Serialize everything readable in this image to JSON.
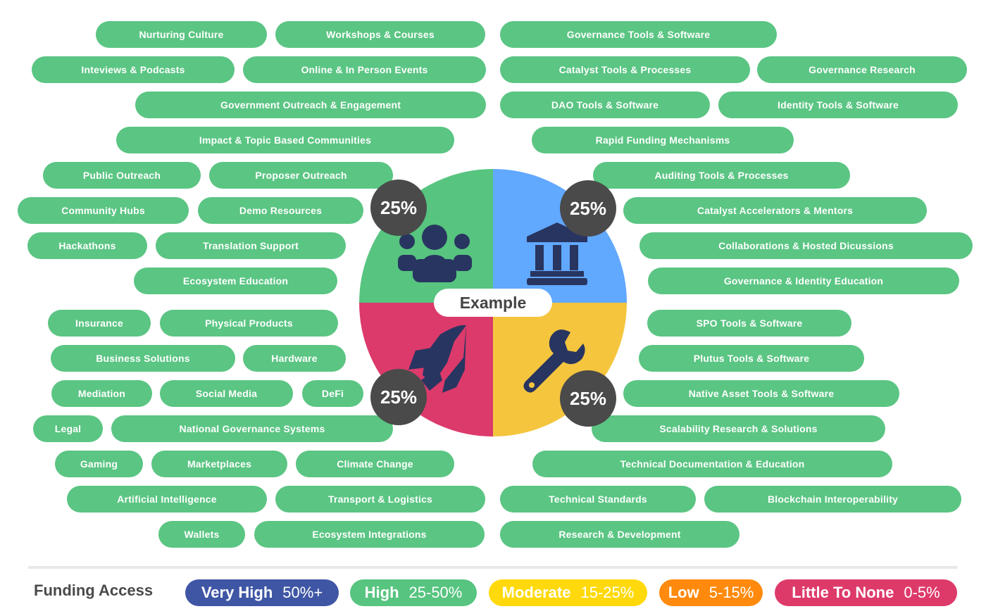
{
  "center_label": "Example",
  "quadrants": [
    {
      "name": "community",
      "icon": "people-group-icon",
      "percent": "25%",
      "color": "#57c47f"
    },
    {
      "name": "governance",
      "icon": "bank-building-icon",
      "percent": "25%",
      "color": "#61a8ff"
    },
    {
      "name": "products",
      "icon": "rocket-icon",
      "percent": "25%",
      "color": "#dc3a6b"
    },
    {
      "name": "development",
      "icon": "wrench-icon",
      "percent": "25%",
      "color": "#f5c53e"
    }
  ],
  "tags": [
    "Nurturing Culture",
    "Workshops & Courses",
    "Governance Tools & Software",
    "Inteviews & Podcasts",
    "Online & In Person Events",
    "Catalyst Tools & Processes",
    "Governance Research",
    "Government Outreach & Engagement",
    "DAO Tools & Software",
    "Identity Tools & Software",
    "Impact & Topic Based Communities",
    "Rapid Funding Mechanisms",
    "Public Outreach",
    "Proposer Outreach",
    "Auditing Tools & Processes",
    "Community Hubs",
    "Demo Resources",
    "Catalyst Accelerators & Mentors",
    "Hackathons",
    "Translation Support",
    "Collaborations & Hosted Dicussions",
    "Ecosystem Education",
    "Governance & Identity Education",
    "Insurance",
    "Physical Products",
    "SPO Tools & Software",
    "Business Solutions",
    "Hardware",
    "Plutus Tools & Software",
    "Mediation",
    "Social Media",
    "DeFi",
    "Native Asset Tools & Software",
    "Legal",
    "National Governance Systems",
    "Scalability Research & Solutions",
    "Gaming",
    "Marketplaces",
    "Climate Change",
    "Technical Documentation & Education",
    "Artificial Intelligence",
    "Transport & Logistics",
    "Technical Standards",
    "Blockchain Interoperability",
    "Wallets",
    "Ecosystem Integrations",
    "Research & Development"
  ],
  "tag_color": "#5bc583",
  "legend": {
    "title": "Funding Access",
    "items": [
      {
        "label": "Very High",
        "range": "50%+",
        "color": "#3f56a5"
      },
      {
        "label": "High",
        "range": "25-50%",
        "color": "#57c47f"
      },
      {
        "label": "Moderate",
        "range": "15-25%",
        "color": "#ffd90b"
      },
      {
        "label": "Low",
        "range": "5-15%",
        "color": "#ff8a0d"
      },
      {
        "label": "Little To None",
        "range": "0-5%",
        "color": "#dd3a6a"
      }
    ]
  }
}
